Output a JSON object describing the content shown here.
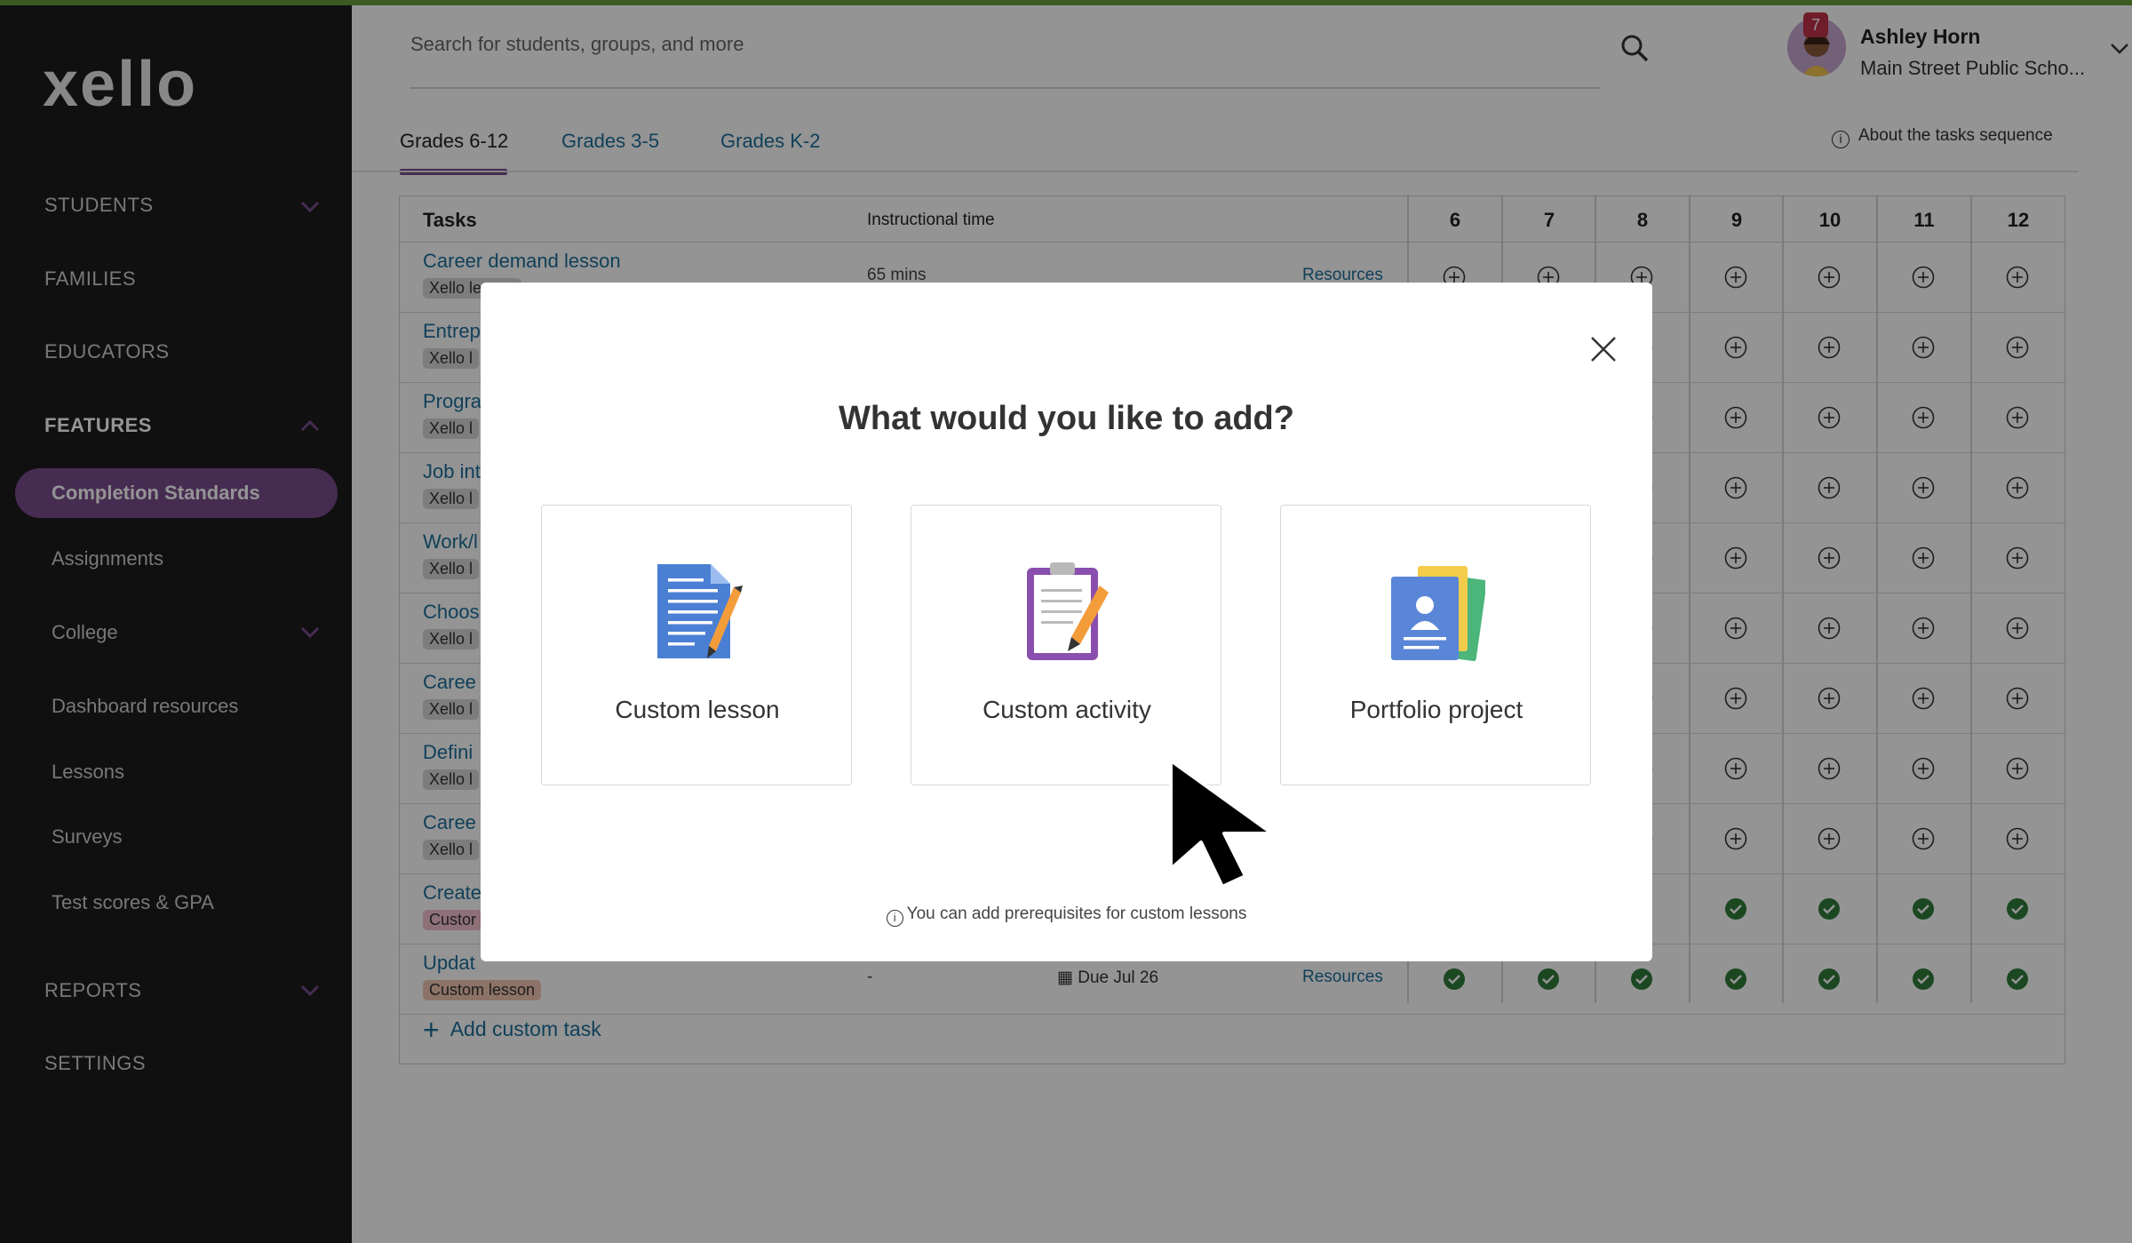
{
  "app": {
    "logo_text": "xello",
    "accent_color": "#7a4c8e",
    "brand_green": "#6a9c3a"
  },
  "sidebar": {
    "sections": [
      {
        "label": "STUDENTS",
        "expandable": true
      },
      {
        "label": "FAMILIES"
      },
      {
        "label": "EDUCATORS"
      },
      {
        "label": "FEATURES",
        "expanded": true
      }
    ],
    "features_items": [
      "Completion Standards",
      "Assignments",
      "College",
      "Dashboard resources",
      "Lessons",
      "Surveys",
      "Test scores & GPA"
    ],
    "active_item": "Completion Standards",
    "bottom_sections": [
      {
        "label": "REPORTS",
        "expandable": true
      },
      {
        "label": "SETTINGS"
      }
    ]
  },
  "header": {
    "search_placeholder": "Search for students, groups, and more",
    "user_name": "Ashley Horn",
    "user_school": "Main Street Public Scho...",
    "notification_count": "7"
  },
  "tabs": [
    "Grades 6-12",
    "Grades 3-5",
    "Grades K-2"
  ],
  "active_tab": "Grades 6-12",
  "about_link": "About the tasks sequence",
  "table": {
    "col_tasks": "Tasks",
    "col_time": "Instructional time",
    "grades": [
      "6",
      "7",
      "8",
      "9",
      "10",
      "11",
      "12"
    ],
    "rows": [
      {
        "name": "Career demand lesson",
        "tag": "Xello lesson",
        "time": "65 mins",
        "resources": "Resources"
      },
      {
        "name": "Entrep",
        "tag": "Xello l"
      },
      {
        "name": "Progra",
        "tag": "Xello l"
      },
      {
        "name": "Job int",
        "tag": "Xello l"
      },
      {
        "name": "Work/l",
        "tag": "Xello l"
      },
      {
        "name": "Choos",
        "tag": "Xello l"
      },
      {
        "name": "Caree",
        "tag": "Xello l"
      },
      {
        "name": "Defini",
        "tag": "Xello l"
      },
      {
        "name": "Caree",
        "tag": "Xello l"
      },
      {
        "name": "Create",
        "tag": "Custor"
      },
      {
        "name": "Updat",
        "tag": "Custom lesson",
        "time": "-",
        "due": "Due Jul 26",
        "resources": "Resources"
      }
    ],
    "add_custom_task": "Add custom task"
  },
  "modal": {
    "title": "What would you like to add?",
    "options": [
      "Custom lesson",
      "Custom activity",
      "Portfolio project"
    ],
    "note": "You can add prerequisites for custom lessons"
  }
}
